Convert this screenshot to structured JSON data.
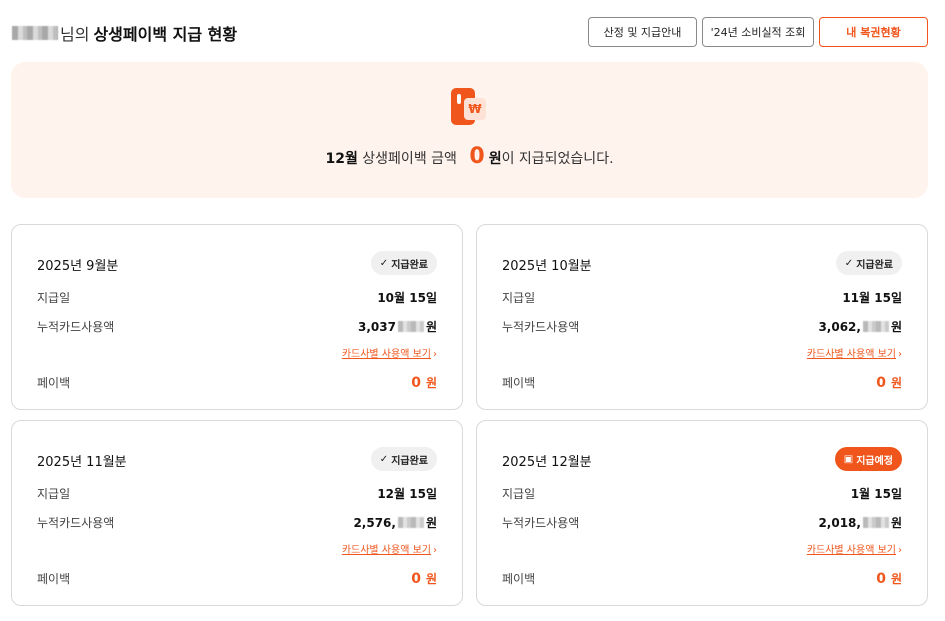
{
  "header": {
    "title_suffix": "님의",
    "title_main": "상생페이백 지급 현황",
    "buttons": {
      "guide": "산정 및 지급안내",
      "past": "'24년 소비실적 조회",
      "mine": "내 복권현황"
    }
  },
  "summary": {
    "month": "12월",
    "text_before": "상생페이백 금액",
    "amount": "0",
    "won": "원",
    "text_after": "이 지급되었습니다.",
    "coin_symbol": "₩"
  },
  "labels": {
    "pay_date": "지급일",
    "card_usage": "누적카드사용액",
    "payback": "페이백",
    "detail_link": "카드사별 사용액 보기",
    "won": "원"
  },
  "cards": [
    {
      "period": "2025년 9월분",
      "status": "지급완료",
      "status_type": "done",
      "pay_date": "10월 15일",
      "usage_visible": "3,037",
      "payback": "0"
    },
    {
      "period": "2025년 10월분",
      "status": "지급완료",
      "status_type": "done",
      "pay_date": "11월 15일",
      "usage_visible": "3,062,",
      "payback": "0"
    },
    {
      "period": "2025년 11월분",
      "status": "지급완료",
      "status_type": "done",
      "pay_date": "12월 15일",
      "usage_visible": "2,576,",
      "payback": "0"
    },
    {
      "period": "2025년 12월분",
      "status": "지급예정",
      "status_type": "scheduled",
      "pay_date": "1월 15일",
      "usage_visible": "2,018,",
      "payback": "0"
    }
  ],
  "colors": {
    "accent": "#f0561c",
    "summary_bg": "#fff3ee",
    "badge_done_bg": "#f0f0f0"
  },
  "icons": {
    "done": "check-icon",
    "scheduled": "calendar-icon",
    "link": "chevron-right-icon"
  }
}
